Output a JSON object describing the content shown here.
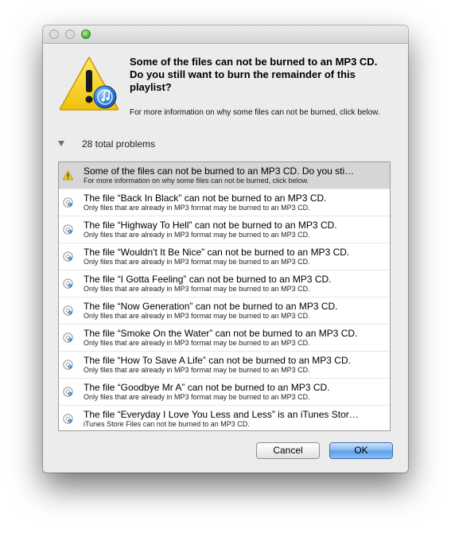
{
  "alert": {
    "title": "Some of the files can not be burned to an MP3 CD. Do you still want to burn the remainder of this playlist?",
    "info": "For more information on why some files can not be burned, click below."
  },
  "disclosure": {
    "label": "28 total problems",
    "expanded": true
  },
  "problems": [
    {
      "title": "Some of the files can not be burned to an MP3 CD. Do you sti…",
      "detail": "For more information on why some files can not be burned, click below.",
      "icon": "warning-icon",
      "selected": true
    },
    {
      "title": "The file “Back In Black” can not be burned to an MP3 CD.",
      "detail": "Only files that are already in MP3 format may be burned to an MP3 CD.",
      "icon": "info-icon"
    },
    {
      "title": "The file “Highway To Hell” can not be burned to an MP3 CD.",
      "detail": "Only files that are already in MP3 format may be burned to an MP3 CD.",
      "icon": "info-icon"
    },
    {
      "title": "The file “Wouldn't It Be Nice” can not be burned to an MP3 CD.",
      "detail": "Only files that are already in MP3 format may be burned to an MP3 CD.",
      "icon": "info-icon"
    },
    {
      "title": "The file “I Gotta Feeling” can not be burned to an MP3 CD.",
      "detail": "Only files that are already in MP3 format may be burned to an MP3 CD.",
      "icon": "info-icon"
    },
    {
      "title": "The file “Now Generation” can not be burned to an MP3 CD.",
      "detail": "Only files that are already in MP3 format may be burned to an MP3 CD.",
      "icon": "info-icon"
    },
    {
      "title": "The file “Smoke On the Water” can not be burned to an MP3 CD.",
      "detail": "Only files that are already in MP3 format may be burned to an MP3 CD.",
      "icon": "info-icon"
    },
    {
      "title": "The file “How To Save A Life” can not be burned to an MP3 CD.",
      "detail": "Only files that are already in MP3 format may be burned to an MP3 CD.",
      "icon": "info-icon"
    },
    {
      "title": "The file “Goodbye Mr A” can not be burned to an MP3 CD.",
      "detail": "Only files that are already in MP3 format may be burned to an MP3 CD.",
      "icon": "info-icon"
    },
    {
      "title": "The file “Everyday I Love You Less and Less” is an iTunes Stor…",
      "detail": "iTunes Store Files can not be burned to an MP3 CD.",
      "icon": "info-icon"
    }
  ],
  "buttons": {
    "cancel": "Cancel",
    "ok": "OK"
  },
  "colors": {
    "selected_row": "#d6d6d6",
    "default_button": "#5c9ce6",
    "warning_yellow": "#f5d21c"
  }
}
